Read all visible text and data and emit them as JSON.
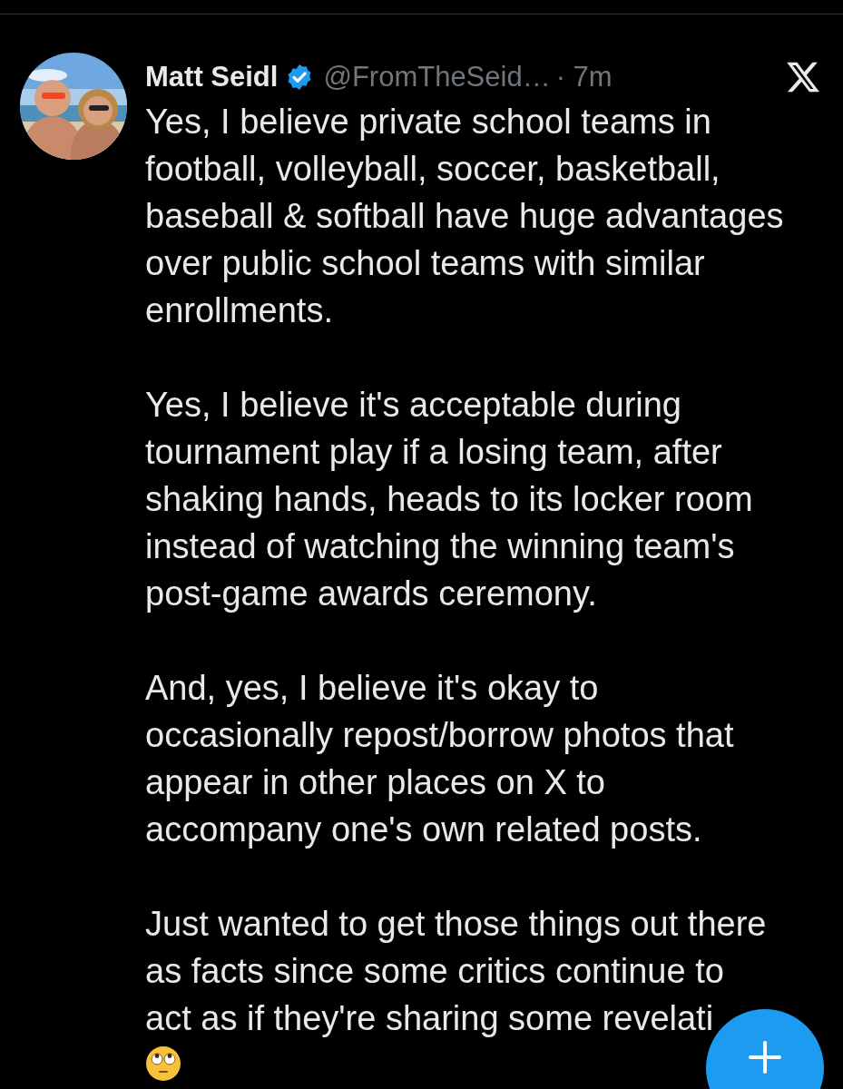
{
  "post": {
    "author": {
      "name": "Matt Seidl",
      "verified": true,
      "handle": "@FromTheSeid…",
      "time": "· 7m"
    },
    "paragraphs": [
      {
        "lines": [
          "Yes, I believe private school teams in",
          "football, volleyball, soccer, basketball,",
          "baseball & softball have huge advantages",
          "over public school teams with similar",
          "enrollments."
        ]
      },
      {
        "lines": [
          "Yes, I believe it's acceptable during",
          "tournament play if a losing team, after",
          "shaking hands, heads to its locker room",
          "instead of watching the winning team's",
          "post-game awards ceremony."
        ]
      },
      {
        "lines": [
          "And, yes, I believe it's okay to",
          "occasionally repost/borrow photos that",
          "appear in other places on X to",
          "accompany one's own related posts."
        ]
      },
      {
        "lines": [
          "Just wanted to get those things out there",
          "as facts since some critics continue to",
          "act as if they're sharing some revelati"
        ]
      }
    ]
  }
}
